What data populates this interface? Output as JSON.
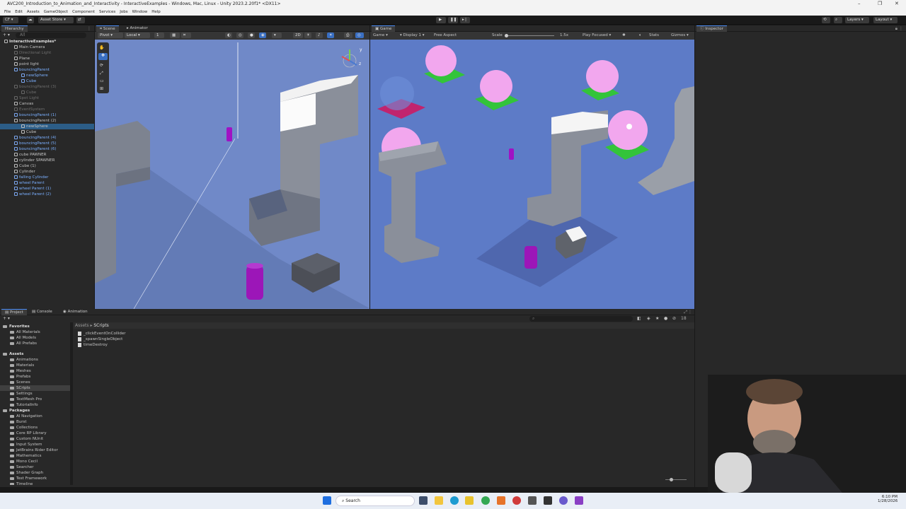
{
  "window": {
    "title": "AVC200_Introduction_to_Animation_and_Interactivity - InteractiveExamples - Windows, Mac, Linux - Unity 2023.2.20f1* <DX11>"
  },
  "menu": [
    "File",
    "Edit",
    "Assets",
    "GameObject",
    "Component",
    "Services",
    "Jobs",
    "Window",
    "Help"
  ],
  "toolbar": {
    "account": "CF",
    "asset_store": "Asset Store",
    "layers": "Layers",
    "layout": "Layout"
  },
  "hierarchy": {
    "tab": "Hierarchy",
    "search_placeholder": "All",
    "items": [
      {
        "label": "InteractiveExamples*",
        "kind": "root"
      },
      {
        "label": "Main Camera",
        "kind": "normal"
      },
      {
        "label": "Directional Light",
        "kind": "dis"
      },
      {
        "label": "Plane",
        "kind": "normal"
      },
      {
        "label": "point light",
        "kind": "normal"
      },
      {
        "label": "bouncingParent",
        "kind": "prefab"
      },
      {
        "label": "newSphere",
        "kind": "prefab"
      },
      {
        "label": "Cube",
        "kind": "prefab"
      },
      {
        "label": "bouncingParent (3)",
        "kind": "dis"
      },
      {
        "label": "Cube",
        "kind": "dis"
      },
      {
        "label": "Spot Light",
        "kind": "dis"
      },
      {
        "label": "Canvas",
        "kind": "normal"
      },
      {
        "label": "EventSystem",
        "kind": "dis"
      },
      {
        "label": "bouncingParent (1)",
        "kind": "prefab"
      },
      {
        "label": "bouncingParent (2)",
        "kind": "normal"
      },
      {
        "label": "newSphere",
        "kind": "sel"
      },
      {
        "label": "Cube",
        "kind": "normal"
      },
      {
        "label": "bouncingParent (4)",
        "kind": "prefab"
      },
      {
        "label": "bouncingParent (5)",
        "kind": "prefab"
      },
      {
        "label": "bouncingParent (6)",
        "kind": "prefab"
      },
      {
        "label": "cube PAWNER",
        "kind": "normal"
      },
      {
        "label": "cylinder SPAWNER",
        "kind": "normal"
      },
      {
        "label": "Cube (1)",
        "kind": "normal"
      },
      {
        "label": "Cylinder",
        "kind": "normal"
      },
      {
        "label": "falling Cylinder",
        "kind": "prefab"
      },
      {
        "label": "wheel Parent",
        "kind": "prefab"
      },
      {
        "label": "wheel Parent (1)",
        "kind": "prefab"
      },
      {
        "label": "wheel Parent (2)",
        "kind": "prefab"
      }
    ]
  },
  "scene": {
    "tabs": [
      "Scene",
      "Animator"
    ],
    "pivot": "Pivot",
    "local": "Local",
    "grid_value": "1"
  },
  "game": {
    "tab": "Game",
    "mode": "Game",
    "display": "Display 1",
    "aspect": "Free Aspect",
    "scale_label": "Scale",
    "scale_value": "1.5x",
    "play_focus": "Play Focused",
    "stats": "Stats",
    "gizmos": "Gizmos"
  },
  "inspector": {
    "tab": "Inspector"
  },
  "project": {
    "tabs": [
      "Project",
      "Console",
      "Animation"
    ],
    "breadcrumb": [
      "Assets",
      "SCripts"
    ],
    "favorites_label": "Favorites",
    "favorites": [
      "All Materials",
      "All Models",
      "All Prefabs"
    ],
    "assets_label": "Assets",
    "asset_folders": [
      "Animations",
      "Materials",
      "Meshes",
      "Prefabs",
      "Scenes",
      "SCripts",
      "Settings",
      "TextMesh Pro",
      "TutorialInfo"
    ],
    "packages_label": "Packages",
    "packages": [
      "AI Navigation",
      "Burst",
      "Collections",
      "Core RP Library",
      "Custom NUnit",
      "Input System",
      "JetBrains Rider Editor",
      "Mathematics",
      "Mono Cecil",
      "Searcher",
      "Shader Graph",
      "Test Framework",
      "Timeline"
    ],
    "files": [
      "_clickEventOnCollider",
      "_spawnSingleObject",
      "timeDestroy"
    ],
    "hidden_count": "18"
  },
  "taskbar": {
    "search_label": "Search",
    "time": "6:10 PM",
    "date": "1/28/2026"
  },
  "colors": {
    "scene_bg": "#6f89c9",
    "game_bg": "#5b79c6",
    "selection": "#2c5d87",
    "prefab_text": "#7bb0ff"
  }
}
